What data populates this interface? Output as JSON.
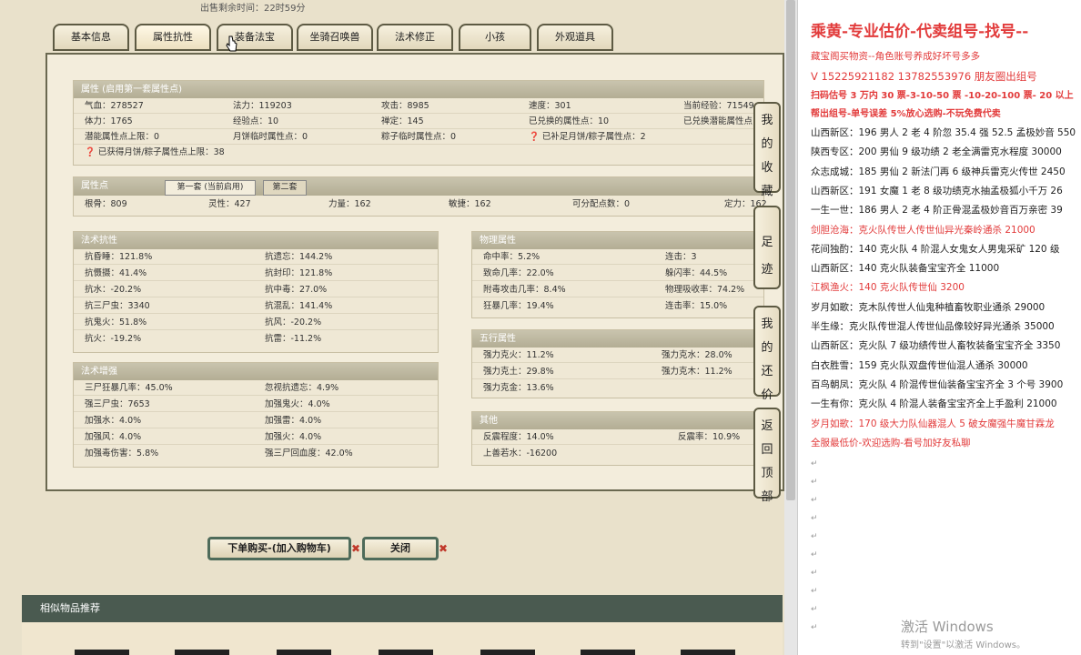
{
  "top_text": "出售剩余时间：22时59分",
  "tabs": [
    "基本信息",
    "属性抗性",
    "装备法宝",
    "坐骑召唤兽",
    "法术修正",
    "小孩",
    "外观道具"
  ],
  "attr": {
    "title": "属性 (启用第一套属性点)",
    "rows": [
      [
        "气血：278527",
        "法力：119203",
        "攻击：8985",
        "速度：301",
        "当前经验：71549"
      ],
      [
        "体力：1765",
        "经验点：10",
        "禅定：145",
        "已兑换的属性点：10",
        "已兑换潜能属性点"
      ],
      [
        "潜能属性点上限：0",
        "月饼临时属性点：0",
        "粽子临时属性点：0",
        "已补足月饼/粽子属性点：2",
        ""
      ],
      [
        "已获得月饼/粽子属性点上限：38",
        "",
        "",
        "",
        ""
      ]
    ]
  },
  "points": {
    "title": "属性点",
    "tab1": "第一套 (当前启用)",
    "tab2": "第二套",
    "values": [
      "根骨：809",
      "灵性：427",
      "力量：162",
      "敏捷：162",
      "可分配点数：0",
      "定力：162"
    ]
  },
  "resist": {
    "title": "法术抗性",
    "rows": [
      [
        "抗昏睡：121.8%",
        "抗遗忘：144.2%"
      ],
      [
        "抗慑摄：41.4%",
        "抗封印：121.8%"
      ],
      [
        "抗水：-20.2%",
        "抗中毒：27.0%"
      ],
      [
        "抗三尸虫：3340",
        "抗混乱：141.4%"
      ],
      [
        "抗鬼火：51.8%",
        "抗风：-20.2%"
      ],
      [
        "抗火：-19.2%",
        "抗雷：-11.2%"
      ]
    ]
  },
  "enhance": {
    "title": "法术增强",
    "rows": [
      [
        "三尸狂暴几率：45.0%",
        "忽视抗遗忘：4.9%"
      ],
      [
        "强三尸虫：7653",
        "加强鬼火：4.0%"
      ],
      [
        "加强水：4.0%",
        "加强雷：4.0%"
      ],
      [
        "加强风：4.0%",
        "加强火：4.0%"
      ],
      [
        "加强毒伤害：5.8%",
        "强三尸回血度：42.0%"
      ]
    ]
  },
  "physical": {
    "title": "物理属性",
    "rows": [
      [
        "命中率：5.2%",
        "连击：3"
      ],
      [
        "致命几率：22.0%",
        "躲闪率：44.5%"
      ],
      [
        "附毒攻击几率：8.4%",
        "物理吸收率：74.2%"
      ],
      [
        "狂暴几率：19.4%",
        "连击率：15.0%"
      ]
    ]
  },
  "wuxing": {
    "title": "五行属性",
    "rows": [
      [
        "强力克火：11.2%",
        "强力克水：28.0%"
      ],
      [
        "强力克土：29.8%",
        "强力克木：11.2%"
      ],
      [
        "强力克金：13.6%",
        ""
      ]
    ]
  },
  "other": {
    "title": "其他",
    "rows": [
      [
        "反震程度：14.0%",
        "反震率：10.9%"
      ],
      [
        "上善若水：-16200",
        ""
      ]
    ]
  },
  "side_buttons": [
    "我的收藏",
    "足迹",
    "我的还价",
    "返回顶部"
  ],
  "buy_button": "下单购买-(加入购物车)",
  "close_button": "关闭",
  "similar_title": "相似物品推荐",
  "right_panel": {
    "title": "乘黄-专业估价-代卖组号-找号--",
    "red_lines": [
      "藏宝阁买物资--角色账号养成好坏号多多",
      "V 15225921182  13782553976 朋友圈出组号",
      "扫码估号 3 万内 30 票-3-10-50 票 -10-20-100 票- 20 以上",
      "帮出组号-单号误差 5%放心选购-不玩免费代卖"
    ],
    "lines": [
      {
        "text": "山西新区：196 男人 2 老 4 阶忽 35.4 强 52.5 孟极妙音 550",
        "color": "#222"
      },
      {
        "text": "陕西专区：200 男仙 9 级功绩 2 老全满雷克水程度 30000",
        "color": "#222"
      },
      {
        "text": "众志成城：185 男仙 2 新法门再 6 级神兵雷克火传世 2450",
        "color": "#222"
      },
      {
        "text": "山西新区：191 女魔 1 老 8 级功绩克水抽孟极狐小千万 26",
        "color": "#222"
      },
      {
        "text": "一生一世：186 男人 2 老 4 阶正骨混孟极妙音百万亲密 39",
        "color": "#222"
      },
      {
        "text": "剑胆沧海：克火队传世人传世仙异光秦岭通杀 21000",
        "color": "#e23b3b"
      },
      {
        "text": "花间独酌：140 克火队 4 阶混人女鬼女人男鬼采矿 120 级",
        "color": "#222"
      },
      {
        "text": "山西新区：140 克火队装备宝宝齐全 11000",
        "color": "#222"
      },
      {
        "text": "江枫渔火：140 克火队传世仙 3200",
        "color": "#e23b3b"
      },
      {
        "text": "岁月如歌：克木队传世人仙鬼种植畜牧职业通杀 29000",
        "color": "#222"
      },
      {
        "text": "半生缘：克火队传世混人传世仙品像较好异光通杀 35000",
        "color": "#222"
      },
      {
        "text": "山西新区：克火队 7 级功绩传世人畜牧装备宝宝齐全 3350",
        "color": "#222"
      },
      {
        "text": "白衣胜雪：159 克火队双盘传世仙混人通杀 30000",
        "color": "#222"
      },
      {
        "text": "百鸟朝凤：克火队 4 阶混传世仙装备宝宝齐全 3 个号 3900",
        "color": "#222"
      },
      {
        "text": "一生有你：克火队 4 阶混人装备宝宝齐全上手盈利 21000",
        "color": "#222"
      },
      {
        "text": "岁月如歌：170 级大力队仙器混人 5 破女魔强牛魔甘霖龙",
        "color": "#e23b3b"
      },
      {
        "text": "全服最低价-欢迎选购-看号加好友私聊",
        "color": "#e23b3b"
      }
    ]
  },
  "watermark": {
    "line1": "激活 Windows",
    "line2": "转到\"设置\"以激活 Windows。"
  }
}
